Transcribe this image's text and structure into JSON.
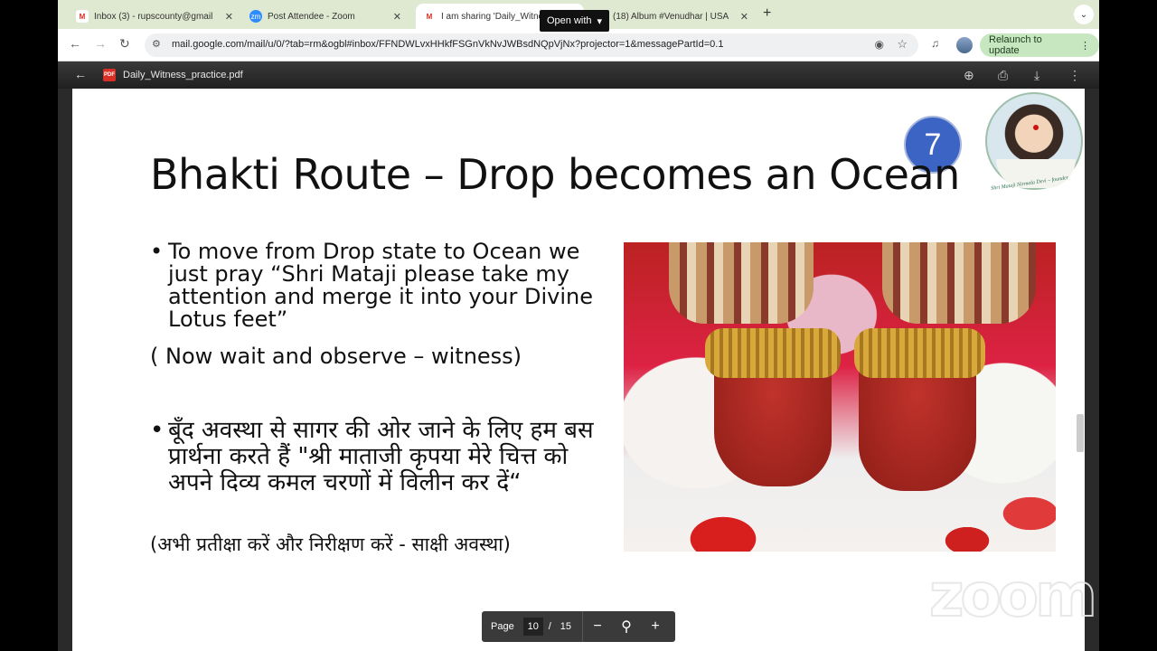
{
  "browser": {
    "tabs": [
      {
        "title": "Inbox (3) - rupscounty@gmail",
        "icon": "gmail-icon",
        "active": false
      },
      {
        "title": "Post Attendee - Zoom",
        "icon": "zoom-icon",
        "active": false
      },
      {
        "title": "I am sharing 'Daily_Witness_",
        "icon": "gmail-icon",
        "active": true
      },
      {
        "title": "(18) Album #Venudhar | USA",
        "icon": "youtube-icon",
        "active": false
      }
    ],
    "url": "mail.google.com/mail/u/0/?tab=rm&ogbl#inbox/FFNDWLvxHHkfFSGnVkNvJWBsdNQpVjNx?projector=1&messagePartId=0.1",
    "relaunch_label": "Relaunch to update"
  },
  "viewer": {
    "filename": "Daily_Witness_practice.pdf",
    "pdf_badge": "PDF",
    "open_with_label": "Open with",
    "page_label": "Page",
    "current_page": "10",
    "page_separator": "/",
    "total_pages": "15"
  },
  "slide": {
    "page_number": "7",
    "portrait_caption": "Shri Mataji Nirmala Devi – founder",
    "title": "Bhakti Route – Drop becomes an Ocean",
    "bullet1": "To move from Drop state to Ocean we just pray “Shri Mataji please take my attention and merge it into your Divine Lotus feet”",
    "bullet1_sub": "( Now wait and observe – witness)",
    "bullet2": "बूँद अवस्था से सागर की ओर जाने के लिए हम बस प्रार्थना करते हैं \"श्री माताजी कृपया मेरे चित्त को अपने दिव्य कमल चरणों में विलीन कर दें“",
    "bullet2_sub": "(अभी प्रतीक्षा करें और निरीक्षण करें - साक्षी अवस्था)",
    "bullet_char": "•"
  },
  "overlay": {
    "zoom_watermark": "zoom"
  },
  "colors": {
    "tabstrip": "#dfe8d0",
    "page_badge": "#3b64c4",
    "relaunch_bg": "#c6e7c0"
  }
}
